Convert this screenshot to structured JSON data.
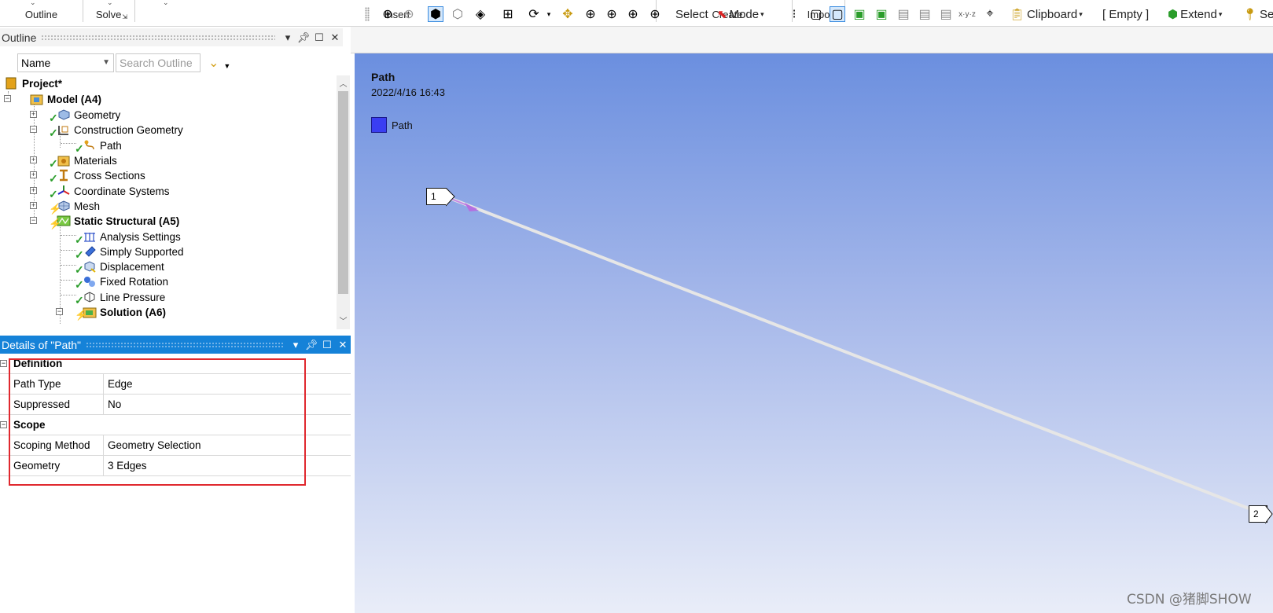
{
  "ribbon": {
    "groups": [
      "Outline",
      "Solve",
      "Insert",
      "Create",
      "Import"
    ]
  },
  "outline": {
    "title": "Outline",
    "name_filter": "Name",
    "search_placeholder": "Search Outline",
    "tree": [
      {
        "label": "Project*",
        "bold": true
      },
      {
        "label": "Model (A4)",
        "bold": true
      },
      {
        "label": "Geometry"
      },
      {
        "label": "Construction Geometry"
      },
      {
        "label": "Path",
        "selected": true
      },
      {
        "label": "Materials"
      },
      {
        "label": "Cross Sections"
      },
      {
        "label": "Coordinate Systems"
      },
      {
        "label": "Mesh"
      },
      {
        "label": "Static Structural (A5)",
        "bold": true
      },
      {
        "label": "Analysis Settings"
      },
      {
        "label": "Simply Supported"
      },
      {
        "label": "Displacement"
      },
      {
        "label": "Fixed Rotation"
      },
      {
        "label": "Line Pressure"
      },
      {
        "label": "Solution (A6)",
        "bold": true
      }
    ]
  },
  "details": {
    "title": "Details of \"Path\"",
    "sections": [
      {
        "name": "Definition",
        "rows": [
          {
            "key": "Path Type",
            "value": "Edge"
          },
          {
            "key": "Suppressed",
            "value": "No"
          }
        ]
      },
      {
        "name": "Scope",
        "rows": [
          {
            "key": "Scoping Method",
            "value": "Geometry Selection"
          },
          {
            "key": "Geometry",
            "value": "3 Edges"
          }
        ]
      }
    ]
  },
  "toolbar": {
    "select_label": "Select",
    "mode_label": "Mode",
    "clipboard_label": "Clipboard",
    "empty_label": "[ Empty ]",
    "extend_label": "Extend",
    "se_label": "Se"
  },
  "viewport": {
    "title": "Path",
    "date": "2022/4/16 16:43",
    "legend_label": "Path",
    "legend_color": "#3a3ef2",
    "start_tag": "1",
    "end_tag": "2",
    "gradient_top": "#6b8fdf",
    "gradient_bottom": "#e9edf8"
  },
  "watermark": "CSDN @猪脚SHOW"
}
